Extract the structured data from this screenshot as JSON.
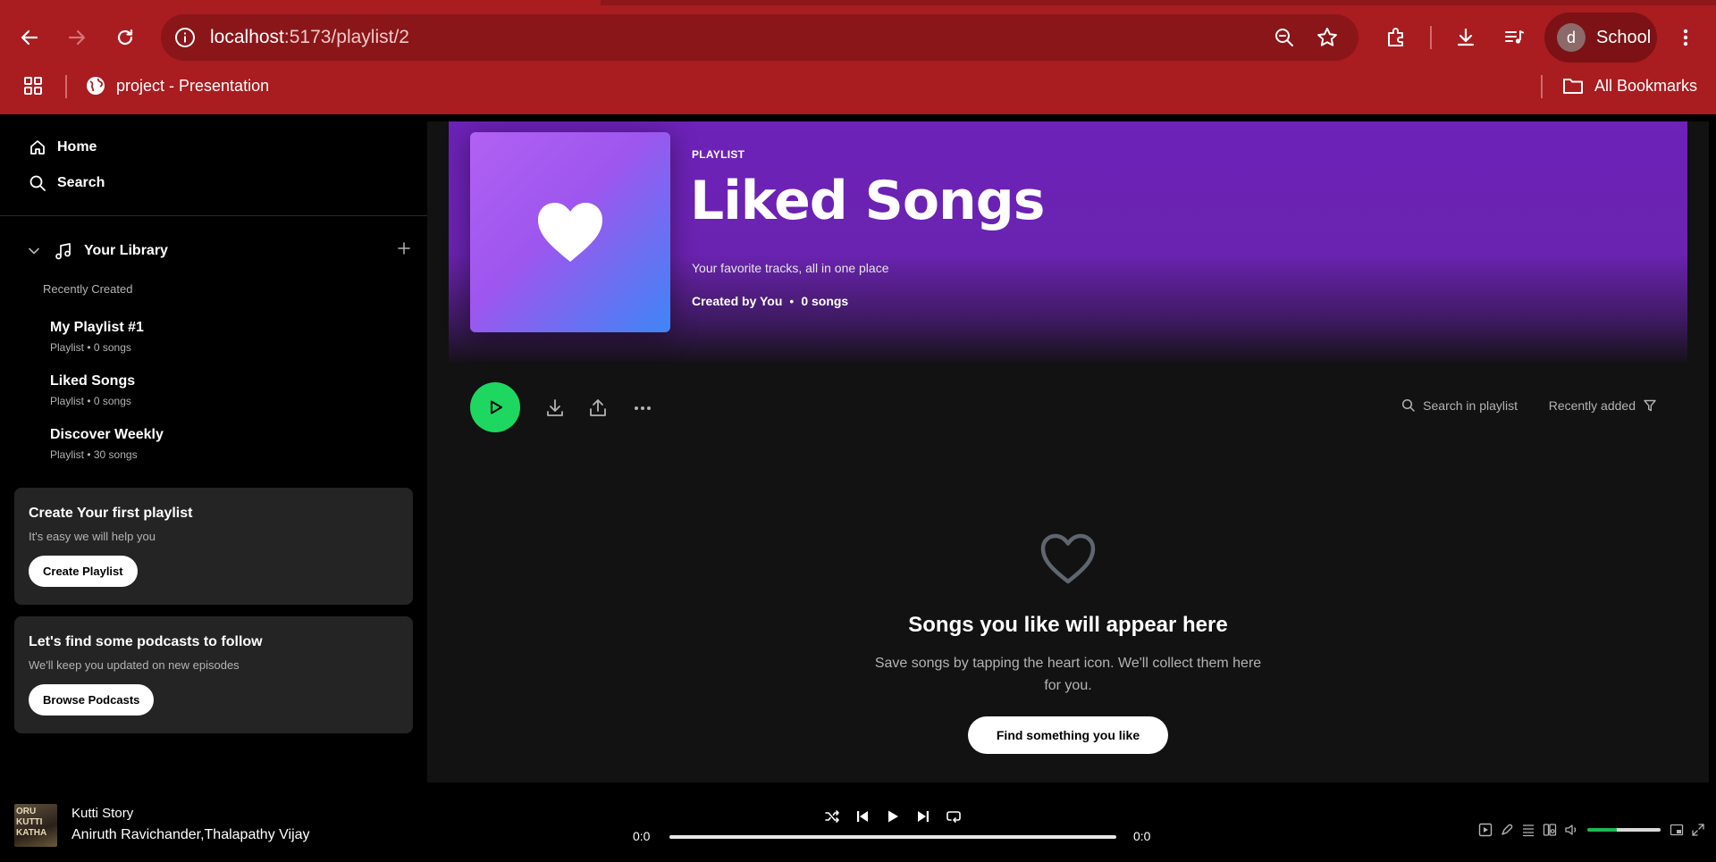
{
  "browser": {
    "url_host": "localhost",
    "url_path": ":5173/playlist/2",
    "profile_initial": "d",
    "profile_name": "School",
    "bookmarks": [
      {
        "label": "project - Presentation"
      },
      {
        "label": "All Bookmarks"
      }
    ]
  },
  "sidebar": {
    "nav": [
      {
        "label": "Home"
      },
      {
        "label": "Search"
      }
    ],
    "library_title": "Your Library",
    "section_label": "Recently Created",
    "playlists": [
      {
        "title": "My Playlist #1",
        "subtitle": "Playlist • 0 songs"
      },
      {
        "title": "Liked Songs",
        "subtitle": "Playlist • 0 songs"
      },
      {
        "title": "Discover Weekly",
        "subtitle": "Playlist • 30 songs"
      }
    ],
    "promos": [
      {
        "title": "Create Your first playlist",
        "subtitle": "It's easy we will help you",
        "button": "Create Playlist"
      },
      {
        "title": "Let's find some podcasts to follow",
        "subtitle": "We'll keep you updated on new episodes",
        "button": "Browse Podcasts"
      }
    ]
  },
  "playlist": {
    "kind": "PLAYLIST",
    "title": "Liked Songs",
    "description": "Your favorite tracks, all in one place",
    "created_by": "Created by You",
    "song_count": "0 songs",
    "search_placeholder": "Search in playlist",
    "sort_label": "Recently added",
    "empty_title": "Songs you like will appear here",
    "empty_subtitle": "Save songs by tapping the heart icon. We'll collect them here for you.",
    "empty_button": "Find something you like"
  },
  "player": {
    "art_text": "ORU KUTTI KATHA",
    "song": "Kutti Story",
    "artist": "Aniruth Ravichander,Thalapathy Vijay",
    "elapsed": "0:0",
    "duration": "0:0",
    "progress": 0,
    "volume": 0.4
  },
  "colors": {
    "chrome": "#a91c20",
    "accent_green": "#1ed760",
    "hero_purple": "#6d22b8"
  }
}
